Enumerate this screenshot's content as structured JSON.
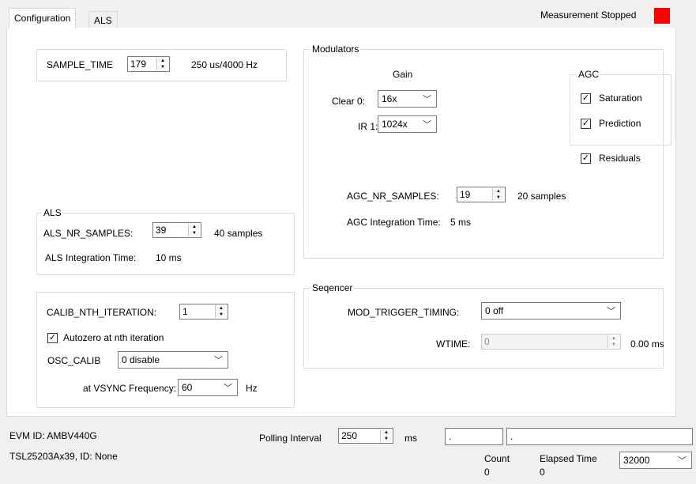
{
  "tabs": [
    "Configuration",
    "ALS"
  ],
  "status": {
    "text": "Measurement Stopped",
    "color": "#ff0000"
  },
  "sample_time": {
    "label": "SAMPLE_TIME",
    "value": "179",
    "info": "250 us/4000 Hz"
  },
  "als": {
    "title": "ALS",
    "nr_samples_label": "ALS_NR_SAMPLES:",
    "nr_samples_value": "39",
    "nr_samples_info": "40 samples",
    "integration_label": "ALS Integration Time:",
    "integration_value": "10 ms"
  },
  "calib": {
    "nth_label": "CALIB_NTH_ITERATION:",
    "nth_value": "1",
    "autozero_label": "Autozero at nth iteration",
    "autozero_checked": true,
    "osc_label": "OSC_CALIB",
    "osc_value": "0 disable",
    "vsync_label": "at VSYNC Frequency:",
    "vsync_value": "60",
    "vsync_unit": "Hz"
  },
  "modulators": {
    "title": "Modulators",
    "gain_header": "Gain",
    "clear_label": "Clear 0:",
    "clear_value": "16x",
    "ir_label": "IR 1:",
    "ir_value": "1024x",
    "agc": {
      "title": "AGC",
      "saturation_label": "Saturation",
      "saturation_checked": true,
      "prediction_label": "Prediction",
      "prediction_checked": true
    },
    "residuals_label": "Residuals",
    "residuals_checked": true,
    "agc_nr_label": "AGC_NR_SAMPLES:",
    "agc_nr_value": "19",
    "agc_nr_info": "20 samples",
    "agc_integration_label": "AGC Integration Time:",
    "agc_integration_value": "5 ms"
  },
  "sequencer": {
    "title": "Seqencer",
    "mod_trigger_label": "MOD_TRIGGER_TIMING:",
    "mod_trigger_value": "0 off",
    "wtime_label": "WTIME:",
    "wtime_value": "0",
    "wtime_info": "0.00 ms"
  },
  "footer": {
    "evm_id": "EVM ID: AMBV440G",
    "device": "TSL25203Ax39,  ID: None",
    "polling_label": "Polling Interval",
    "polling_value": "250",
    "polling_unit": "ms",
    "box1": ".",
    "box2": ".",
    "count_label": "Count",
    "count_value": "0",
    "elapsed_label": "Elapsed Time",
    "elapsed_value": "0",
    "buffer_value": "32000"
  }
}
